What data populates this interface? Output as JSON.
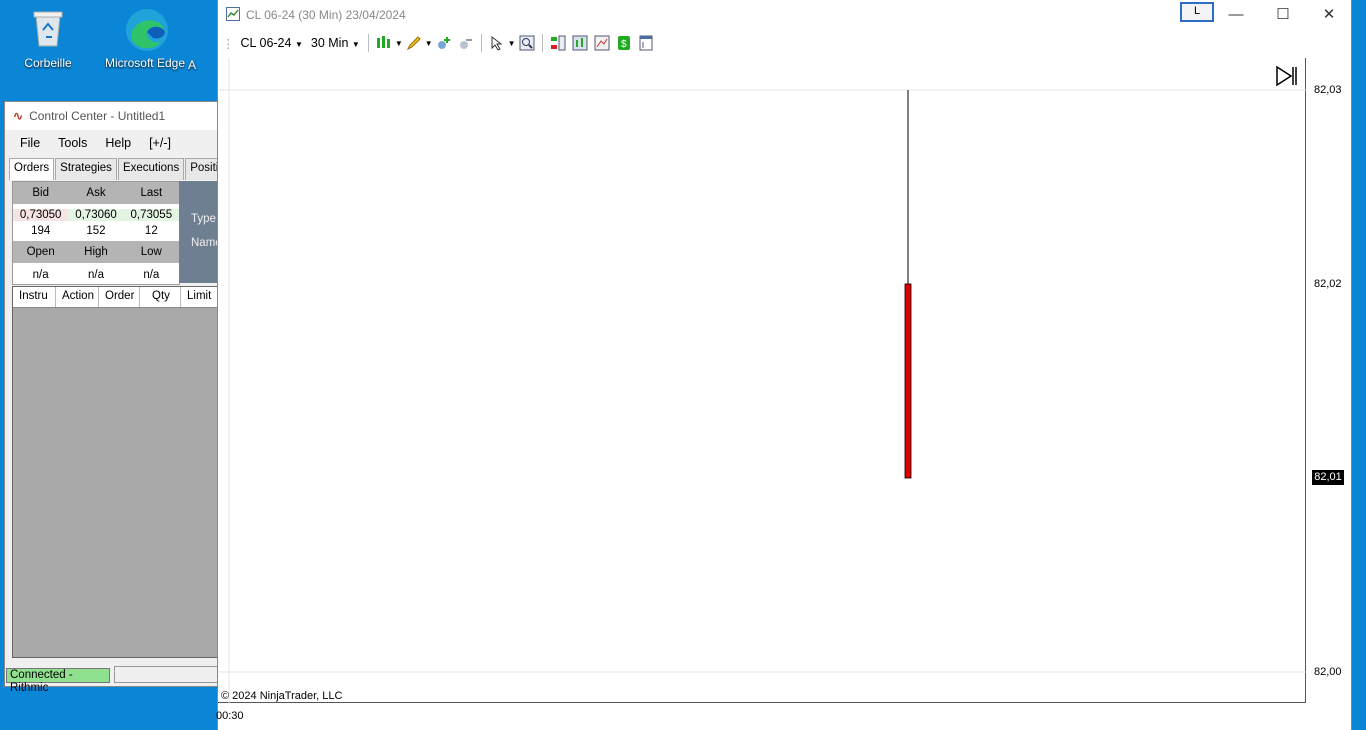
{
  "desktop": {
    "icons": [
      {
        "label": "Corbeille"
      },
      {
        "label": "Microsoft Edge"
      },
      {
        "label": "A"
      }
    ]
  },
  "control_center": {
    "title": "Control Center - Untitled1",
    "menu": [
      "File",
      "Tools",
      "Help",
      "[+/-]"
    ],
    "tabs": [
      "Orders",
      "Strategies",
      "Executions",
      "Position"
    ],
    "quote": {
      "head1": [
        "Bid",
        "Ask",
        "Last"
      ],
      "prices": [
        "0,73050",
        "0,73060",
        "0,73055"
      ],
      "sizes": [
        "194",
        "152",
        "12"
      ],
      "head2": [
        "Open",
        "High",
        "Low"
      ],
      "ohl": [
        "n/a",
        "n/a",
        "n/a"
      ]
    },
    "side_labels": [
      "Type",
      "Name"
    ],
    "grid_columns": [
      "Instru",
      "Action",
      "Order",
      "Qty",
      "Limit"
    ],
    "status": "Connected - Rithmic"
  },
  "chart_window": {
    "title": "CL 06-24 (30 Min)  23/04/2024",
    "l_button": "L",
    "instrument": "CL 06-24",
    "interval": "30 Min",
    "copyright": "© 2024 NinjaTrader, LLC",
    "time_label": "00:30",
    "current_price": "82,01",
    "colors": {
      "down_candle": "#e00000",
      "price_tag": "#000000"
    }
  },
  "chart_data": {
    "type": "candlestick",
    "y_ticks": [
      "82,03",
      "82,02",
      "82,00"
    ],
    "ylim": [
      82.0,
      82.03
    ],
    "candles": [
      {
        "open": 82.02,
        "high": 82.03,
        "low": 82.01,
        "close": 82.01
      }
    ]
  }
}
